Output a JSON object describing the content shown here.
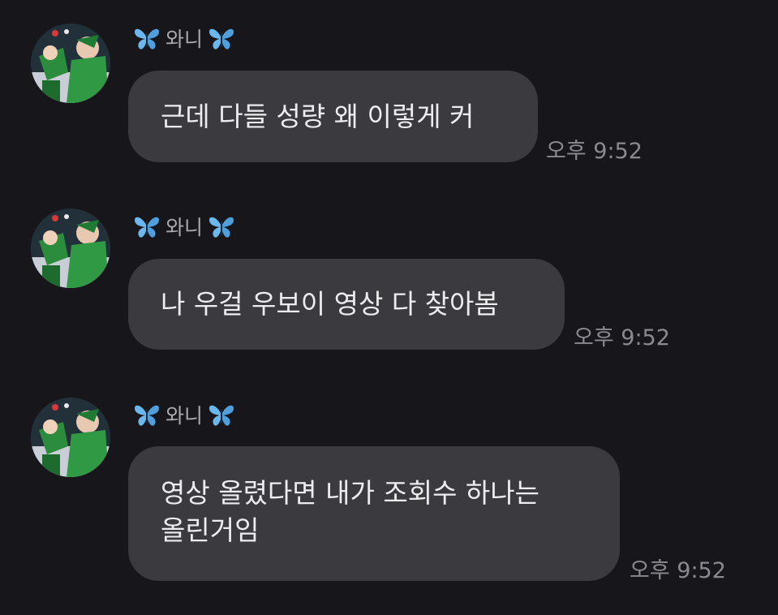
{
  "messages": [
    {
      "sender": "와니",
      "text_lines": [
        "근데 다들 성량 왜 이렇게 커"
      ],
      "time": "오후 9:52"
    },
    {
      "sender": "와니",
      "text_lines": [
        "나 우걸 우보이 영상 다 찾아봄"
      ],
      "time": "오후 9:52"
    },
    {
      "sender": "와니",
      "text_lines": [
        "영상 올렸다면 내가 조회수 하나는",
        "올린거임"
      ],
      "time": "오후 9:52"
    }
  ],
  "icons": {
    "sender_decoration": "butterfly-icon",
    "avatar": "avatar-photo"
  },
  "colors": {
    "background": "#17171b",
    "bubble": "#3a3a3f",
    "butterfly": "#6ab8ee",
    "timestamp": "#8a8a90"
  }
}
